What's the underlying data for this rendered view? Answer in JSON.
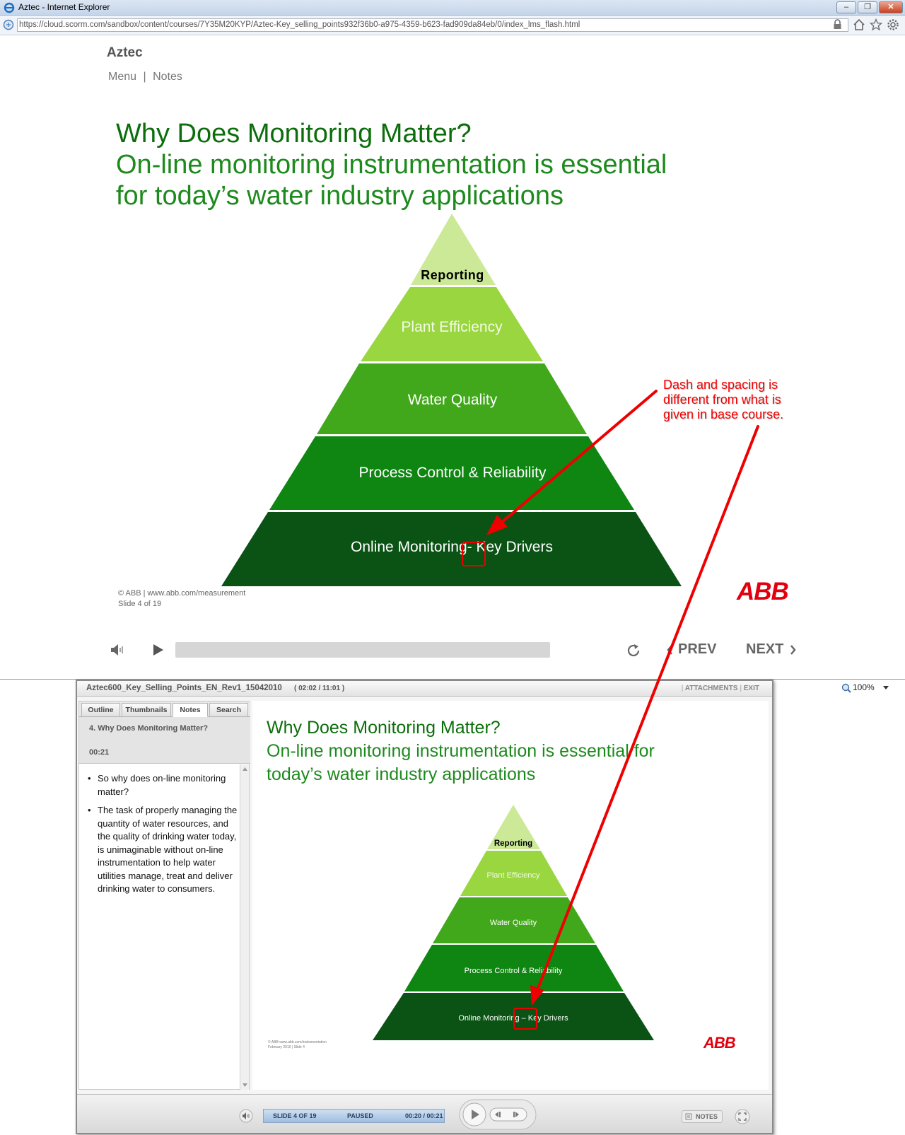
{
  "browser": {
    "window_title": "Aztec - Internet Explorer",
    "url": "https://cloud.scorm.com/sandbox/content/courses/7Y35M20KYP/Aztec-Key_selling_points932f36b0-a975-4359-b623-fad909da84eb/0/index_lms_flash.html",
    "zoom": "100%"
  },
  "top_player": {
    "course_name": "Aztec",
    "nav_menu": "Menu",
    "nav_sep": "|",
    "nav_notes": "Notes",
    "slide": {
      "title_line1": "Why Does Monitoring Matter?",
      "title_line2": "On-line monitoring instrumentation is essential for today’s water industry applications",
      "pyramid": [
        "Reporting",
        "Plant Efficiency",
        "Water Quality",
        "Process Control & Reliability",
        "Online Monitoring- Key Drivers"
      ],
      "footer_line1": "© ABB | www.abb.com/measurement",
      "footer_line2": "Slide 4 of 19",
      "logo": "ABB"
    },
    "controls": {
      "prev": "PREV",
      "next": "NEXT"
    }
  },
  "annotation": {
    "text": "Dash and spacing is different from what is given in base course."
  },
  "lms_player": {
    "header_title": "Aztec600_Key_Selling_Points_EN_Rev1_15042010",
    "header_time": "( 02:02 / 11:01 )",
    "attachments": "ATTACHMENTS",
    "exit": "EXIT",
    "tabs": [
      "Outline",
      "Thumbnails",
      "Notes",
      "Search"
    ],
    "active_tab": "Notes",
    "note_title": "4. Why Does Monitoring Matter?",
    "note_time": "00:21",
    "notes": [
      "So why does on-line monitoring matter?",
      "The task of properly managing the quantity of water resources, and the quality of drinking water today, is unimaginable without on-line instrumentation to help water utilities manage, treat and deliver drinking water to consumers."
    ],
    "slide": {
      "title_line1": "Why Does Monitoring Matter?",
      "title_line2": "On-line monitoring instrumentation is essential for today’s water industry applications",
      "pyramid": [
        "Reporting",
        "Plant Efficiency",
        "Water Quality",
        "Process Control & Reliability",
        "Online Monitoring – Key Drivers"
      ],
      "footer_line1": "© ABB www.abb.com/instrumentation",
      "footer_line2": "February 2010 | Slide 4",
      "logo": "ABB"
    },
    "status": {
      "slide": "SLIDE 4 OF 19",
      "state": "PAUSED",
      "time": "00:20 / 00:21"
    },
    "notes_button": "NOTES"
  },
  "colors": {
    "title_dark_green": "#0b6e0b",
    "title_green": "#1d8a1d",
    "tier1": "#cbe997",
    "tier2": "#99d63f",
    "tier3": "#41a81b",
    "tier4": "#0f8611",
    "tier5": "#0a5314",
    "annotation_red": "#ee0000",
    "abb_red": "#e2000f"
  }
}
